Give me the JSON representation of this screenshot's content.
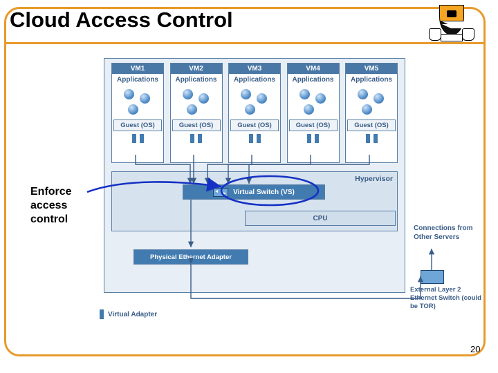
{
  "title": "Cloud Access Control",
  "annotation": "Enforce access control",
  "page_number": "20",
  "legend": {
    "virtual_adapter": "Virtual Adapter"
  },
  "components": {
    "hypervisor": "Hypervisor",
    "virtual_switch": "Virtual Switch (VS)",
    "cpu": "CPU",
    "physical_adapter": "Physical Ethernet Adapter",
    "connections_from": "Connections from Other Servers",
    "external_switch": "External Layer 2 Ethernet Switch (could be TOR)"
  },
  "vm_labels": {
    "apps": "Applications",
    "guest": "Guest (OS)"
  },
  "vms": [
    {
      "name": "VM1"
    },
    {
      "name": "VM2"
    },
    {
      "name": "VM3"
    },
    {
      "name": "VM4"
    },
    {
      "name": "VM5"
    }
  ],
  "colors": {
    "border": "#e79a2a",
    "box_blue": "#427bb0",
    "text_blue": "#3a5d87",
    "annotation_blue": "#1531c4"
  }
}
